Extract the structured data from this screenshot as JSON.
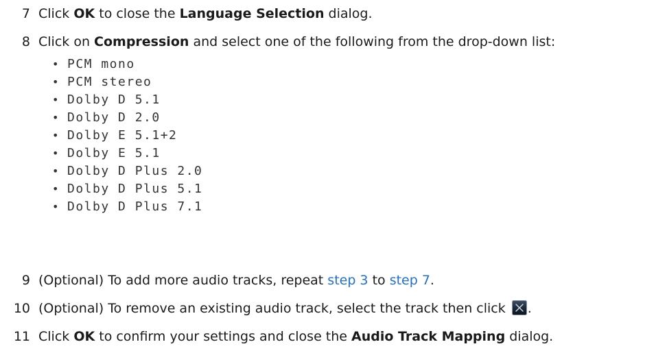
{
  "steps": [
    {
      "number": "7",
      "p1": "Click ",
      "b1": "OK",
      "p2": " to close the ",
      "b2": "Language Selection",
      "p3": " dialog."
    },
    {
      "number": "8",
      "p1": "Click on ",
      "b1": "Compression",
      "p2": " and select one of the following from the drop-down list:",
      "options": [
        "PCM mono",
        "PCM stereo",
        "Dolby D 5.1",
        "Dolby D 2.0",
        "Dolby E 5.1+2",
        "Dolby E 5.1",
        "Dolby D Plus 2.0",
        "Dolby D Plus 5.1",
        "Dolby D Plus 7.1"
      ]
    },
    {
      "number": "9",
      "p1": "(Optional) To add more audio tracks, repeat ",
      "link1": "step 3",
      "p2": " to ",
      "link2": "step 7",
      "p3": "."
    },
    {
      "number": "10",
      "p1": "(Optional) To remove an existing audio track, select the track then click ",
      "icon": "close-x-icon",
      "p2": "."
    },
    {
      "number": "11",
      "p1": "Click ",
      "b1": "OK",
      "p2": " to confirm your settings and close the ",
      "b2": "Audio Track Mapping",
      "p3": " dialog."
    }
  ],
  "colors": {
    "text": "#1a1a1a",
    "link": "#1f6fd6"
  }
}
